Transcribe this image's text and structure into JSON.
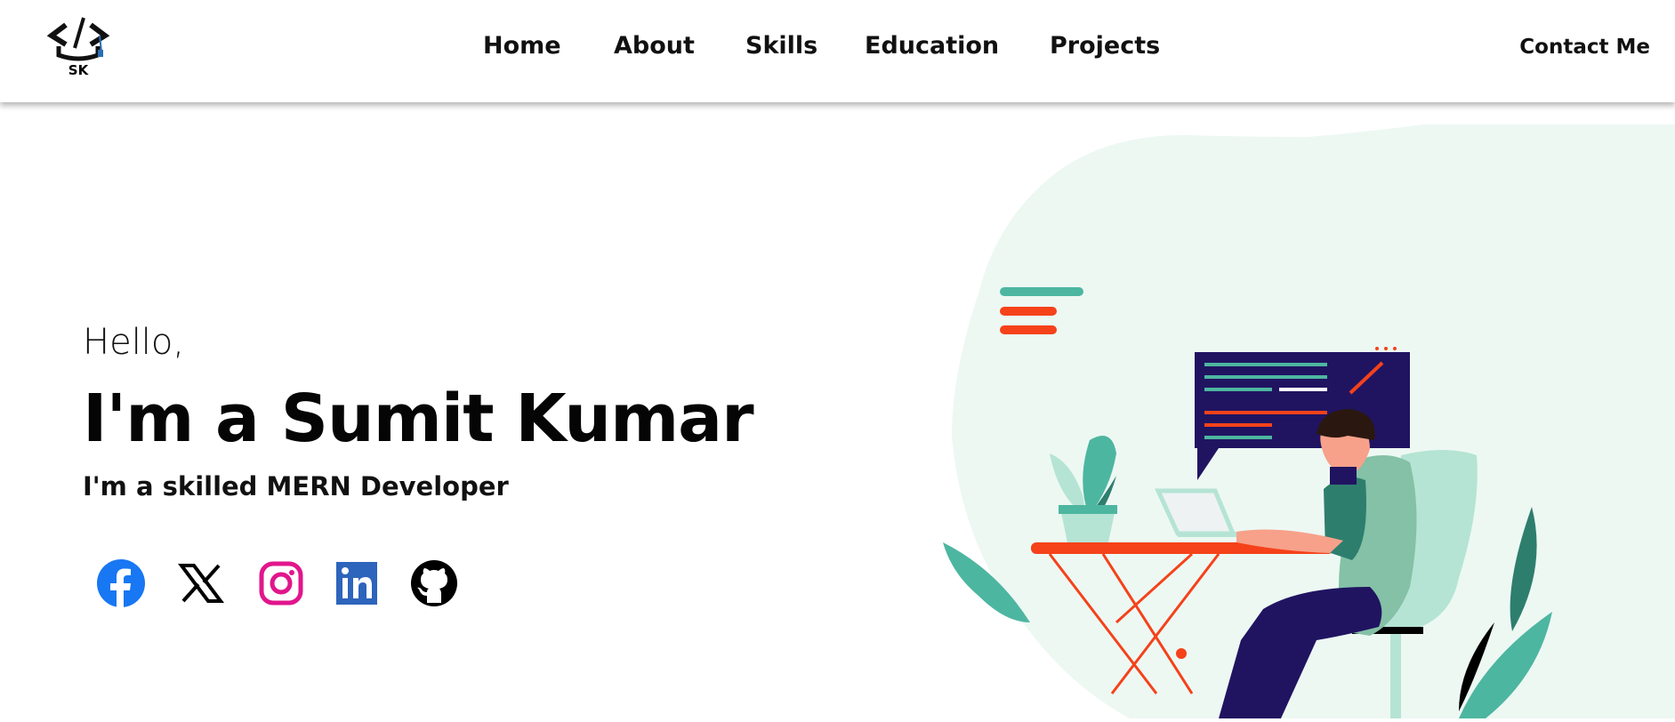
{
  "brand": {
    "logo_text": "SK"
  },
  "nav": {
    "items": [
      {
        "label": "Home"
      },
      {
        "label": "About"
      },
      {
        "label": "Skills"
      },
      {
        "label": "Education"
      },
      {
        "label": "Projects"
      }
    ],
    "contact_label": "Contact Me"
  },
  "hero": {
    "greeting": "Hello,",
    "name": "I'm a Sumit Kumar",
    "role": "I'm a skilled MERN Developer"
  },
  "socials": [
    {
      "icon": "facebook-icon",
      "color": "#1877F2"
    },
    {
      "icon": "x-icon",
      "color": "#000000"
    },
    {
      "icon": "instagram-icon",
      "color": "#E1168C"
    },
    {
      "icon": "linkedin-icon",
      "color": "#2D64BC"
    },
    {
      "icon": "github-icon",
      "color": "#000000"
    }
  ],
  "colors": {
    "teal": "#4DB6A0",
    "mint": "#B5E4D4",
    "blob": "#EDF8F3",
    "orange": "#F5421A",
    "navy": "#201461"
  }
}
